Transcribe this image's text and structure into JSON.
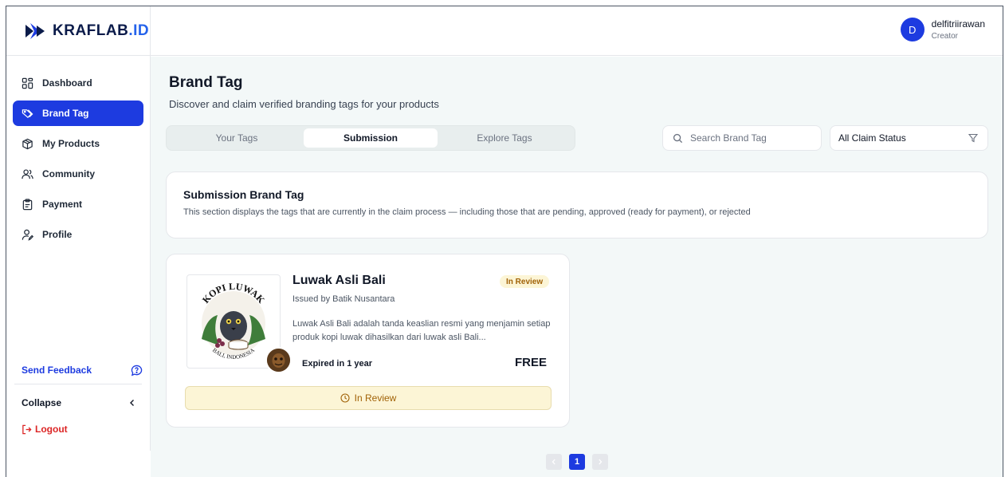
{
  "logo": {
    "text": "KRAFLAB",
    "suffix": ".ID"
  },
  "sidebar": {
    "items": [
      {
        "label": "Dashboard",
        "icon": "dashboard-icon"
      },
      {
        "label": "Brand Tag",
        "icon": "tag-icon",
        "active": true
      },
      {
        "label": "My Products",
        "icon": "box-icon"
      },
      {
        "label": "Community",
        "icon": "users-icon"
      },
      {
        "label": "Payment",
        "icon": "clipboard-icon"
      },
      {
        "label": "Profile",
        "icon": "user-edit-icon"
      }
    ],
    "feedback_label": "Send Feedback",
    "collapse_label": "Collapse",
    "logout_label": "Logout"
  },
  "user": {
    "initial": "D",
    "name": "delfitriirawan",
    "role": "Creator"
  },
  "page": {
    "title": "Brand Tag",
    "subtitle": "Discover and claim verified branding tags for your products"
  },
  "tabs": [
    {
      "label": "Your Tags"
    },
    {
      "label": "Submission",
      "active": true
    },
    {
      "label": "Explore Tags"
    }
  ],
  "search": {
    "placeholder": "Search Brand Tag",
    "value": ""
  },
  "filter": {
    "selected": "All Claim Status"
  },
  "info": {
    "title": "Submission Brand Tag",
    "description": "This section displays the tags that are currently in the claim process — including those that are pending, approved (ready for payment), or rejected"
  },
  "tag_card": {
    "name": "Luwak Asli Bali",
    "badge": "In Review",
    "issued_by": "Issued by Batik Nusantara",
    "description": "Luwak Asli Bali adalah tanda keaslian resmi yang menjamin setiap produk kopi luwak dihasilkan dari luwak asli Bali...",
    "expiry": "Expired in 1 year",
    "price": "FREE",
    "status": "In Review",
    "image_text_top": "KOPI LUWAK",
    "image_text_bottom": "BALI, INDONESIA"
  },
  "pagination": {
    "current": "1"
  },
  "colors": {
    "accent": "#1d3be0",
    "review_bg": "#fcf5d6",
    "review_text": "#a16207",
    "danger": "#dc2626"
  }
}
